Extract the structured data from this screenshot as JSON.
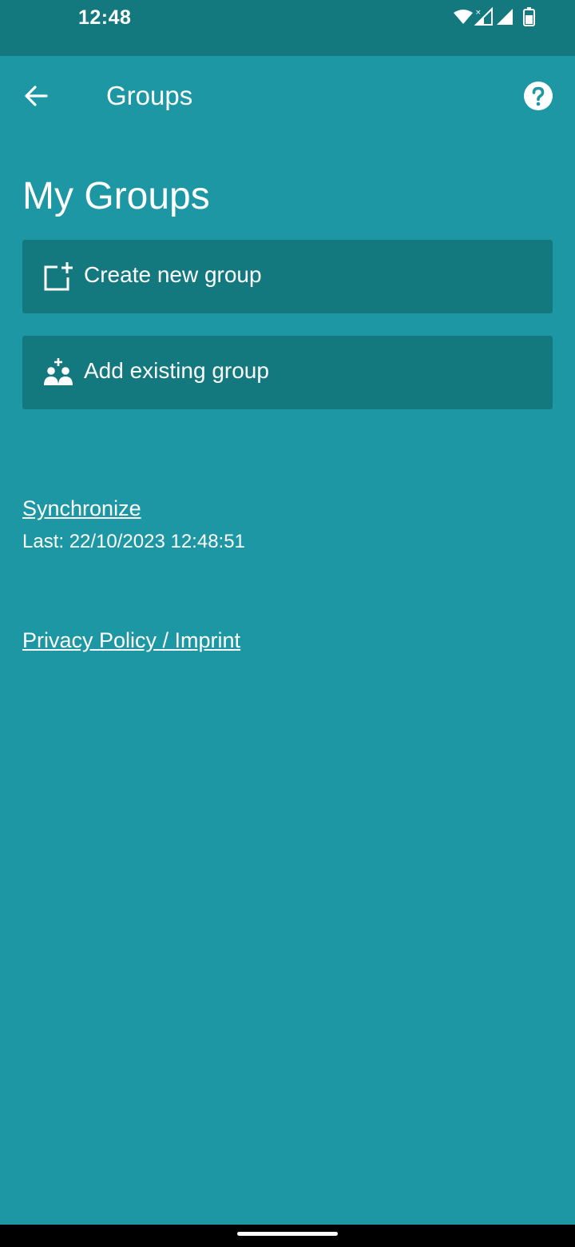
{
  "status_bar": {
    "time": "12:48",
    "icons": [
      "wifi-icon",
      "cell-signal-icon",
      "cell-signal-icon",
      "battery-icon"
    ]
  },
  "app_bar": {
    "title": "Groups",
    "back_icon": "arrow-left-icon",
    "help_icon": "help-circle-icon"
  },
  "main": {
    "heading": "My Groups",
    "actions": [
      {
        "label": "Create new group",
        "icon": "add-box-icon"
      },
      {
        "label": "Add existing group",
        "icon": "group-add-icon"
      }
    ],
    "sync": {
      "link_label": "Synchronize",
      "last_text": "Last: 22/10/2023 12:48:51"
    },
    "privacy_label": "Privacy Policy / Imprint"
  },
  "colors": {
    "background": "#1c97a3",
    "bar": "#13797f",
    "text": "#ffffff"
  }
}
